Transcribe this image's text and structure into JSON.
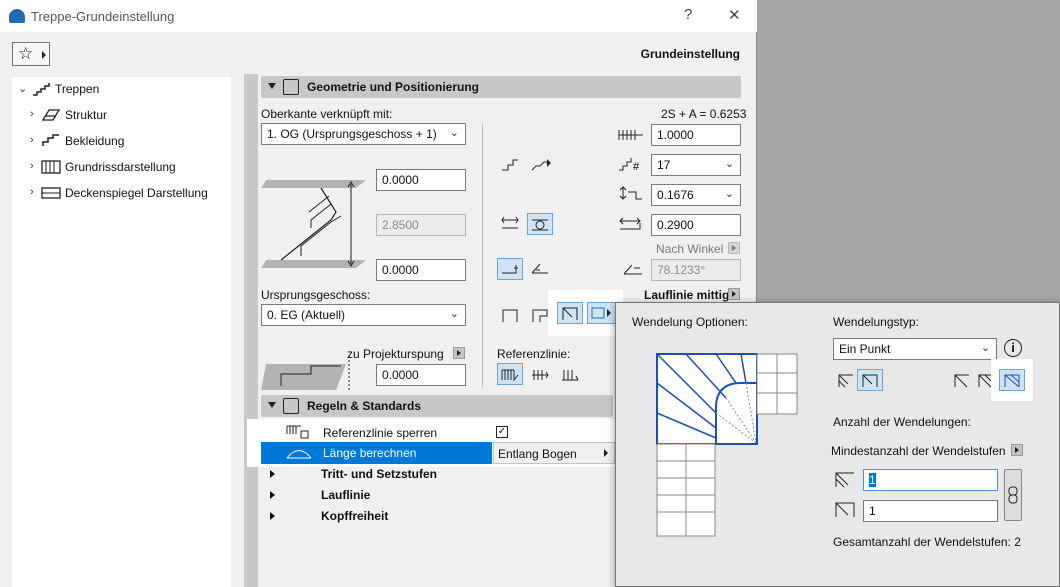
{
  "window": {
    "title": "Treppe-Grundeinstellung",
    "help_label": "?",
    "close_label": "✕",
    "favorites_icon": "star-icon",
    "header_right": "Grundeinstellung"
  },
  "tree": {
    "root": {
      "label": "Treppen",
      "icon": "stair-icon"
    },
    "items": [
      {
        "label": "Struktur",
        "icon": "structure-icon"
      },
      {
        "label": "Bekleidung",
        "icon": "cladding-icon"
      },
      {
        "label": "Grundrissdarstellung",
        "icon": "floorplan-icon"
      },
      {
        "label": "Deckenspiegel Darstellung",
        "icon": "ceiling-plan-icon"
      }
    ]
  },
  "geometry": {
    "section_title": "Geometrie und Positionierung",
    "oberkante_label": "Oberkante verknüpft mit:",
    "oberkante_value": "1. OG (Ursprungsgeschoss + 1)",
    "top_offset": "0.0000",
    "height": "2.8500",
    "bottom_offset": "0.0000",
    "ursprung_label": "Ursprungsgeschoss:",
    "ursprung_value": "0. EG (Aktuell)",
    "projektursprung_label": "zu Projekturspung",
    "projekt_offset": "0.0000",
    "referenzlinie_label": "Referenzlinie:",
    "formula": "2S + A = 0.6253",
    "width": "1.0000",
    "steps": "17",
    "riser_height": "0.1676",
    "tread_depth": "0.2900",
    "nach_winkel": "Nach Winkel",
    "angle": "78.1233°",
    "lauflinie_label": "Lauflinie mittig"
  },
  "rules": {
    "section_title": "Regeln & Standards",
    "rows": [
      {
        "label": "Referenzlinie sperren",
        "checked": true
      },
      {
        "label": "Länge berechnen",
        "value": "Entlang Bogen"
      },
      {
        "label": "Tritt- und Setzstufen"
      },
      {
        "label": "Lauflinie"
      },
      {
        "label": "Kopffreiheit"
      }
    ]
  },
  "popup": {
    "options_label": "Wendelung Optionen:",
    "type_label": "Wendelungstyp:",
    "type_value": "Ein Punkt",
    "info_label": "i",
    "count_label": "Anzahl der Wendelungen:",
    "min_label": "Mindestanzahl der Wendelstufen",
    "value1": "1",
    "value2": "1",
    "total_label": "Gesamtanzahl der Wendelstufen: 2"
  }
}
